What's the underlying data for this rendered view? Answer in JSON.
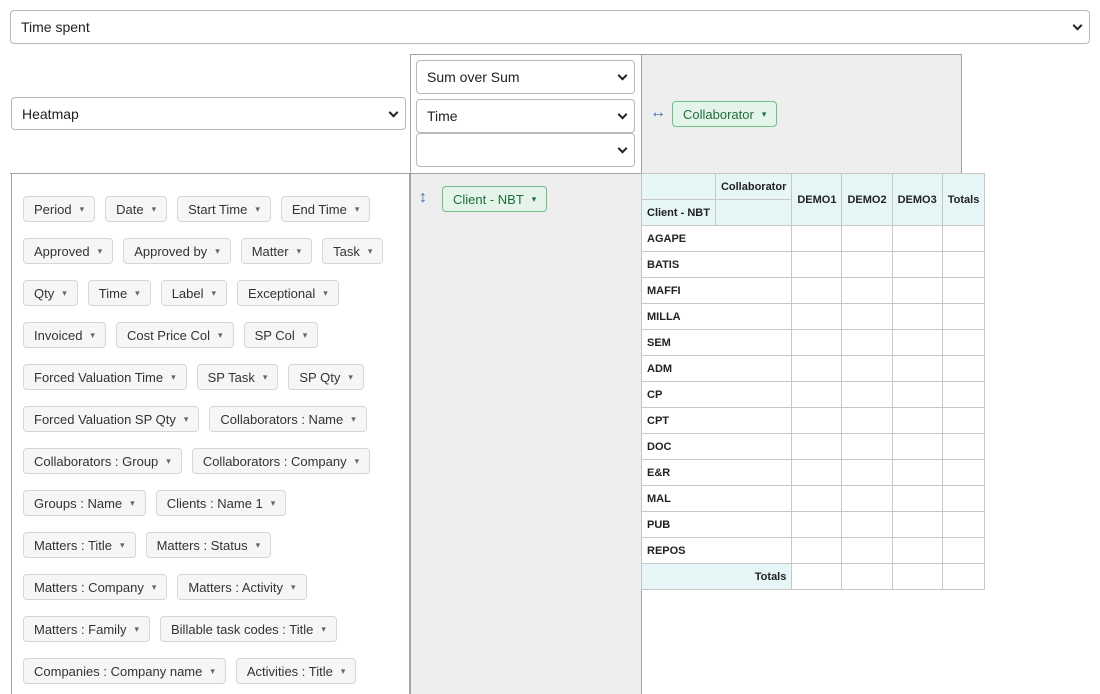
{
  "top_select": {
    "value": "Time spent"
  },
  "renderer_select": {
    "value": "Heatmap"
  },
  "aggregator_select": {
    "value": "Sum over Sum"
  },
  "value_select_1": {
    "value": "Time"
  },
  "value_select_2": {
    "value": ""
  },
  "col_attrs": [
    {
      "label": "Collaborator",
      "caret": "▾"
    }
  ],
  "row_attrs": [
    {
      "label": "Client - NBT",
      "caret": "▾"
    }
  ],
  "unused_attrs": [
    [
      "Period",
      "Date",
      "Start Time",
      "End Time"
    ],
    [
      "Approved",
      "Approved by",
      "Matter",
      "Task"
    ],
    [
      "Qty",
      "Time",
      "Label",
      "Exceptional"
    ],
    [
      "Invoiced",
      "Cost Price Col",
      "SP Col"
    ],
    [
      "Forced Valuation Time",
      "SP Task",
      "SP Qty"
    ],
    [
      "Forced Valuation SP Qty",
      "Collaborators : Name"
    ],
    [
      "Collaborators : Group",
      "Collaborators : Company"
    ],
    [
      "Groups : Name",
      "Clients : Name 1"
    ],
    [
      "Matters : Title",
      "Matters : Status"
    ],
    [
      "Matters : Company",
      "Matters : Activity"
    ],
    [
      "Matters : Family",
      "Billable task codes : Title"
    ],
    [
      "Companies : Company name",
      "Activities : Title"
    ]
  ],
  "caret": "▾",
  "icons": {
    "col_drag": "↔",
    "row_drag": "↕"
  },
  "pivot": {
    "col_attr_label": "Collaborator",
    "row_attr_label": "Client - NBT",
    "columns": [
      "DEMO1",
      "DEMO2",
      "DEMO3",
      "Totals"
    ],
    "rows": [
      "AGAPE",
      "BATIS",
      "MAFFI",
      "MILLA",
      "SEM",
      "ADM",
      "CP",
      "CPT",
      "DOC",
      "E&R",
      "MAL",
      "PUB",
      "REPOS"
    ],
    "totals_label": "Totals"
  },
  "colors": {
    "header_bg": "#e6f5f5",
    "area_gray": "#eeeeee",
    "pill_green_bg": "#e5f4ea",
    "pill_green_border": "#6fbf88"
  }
}
